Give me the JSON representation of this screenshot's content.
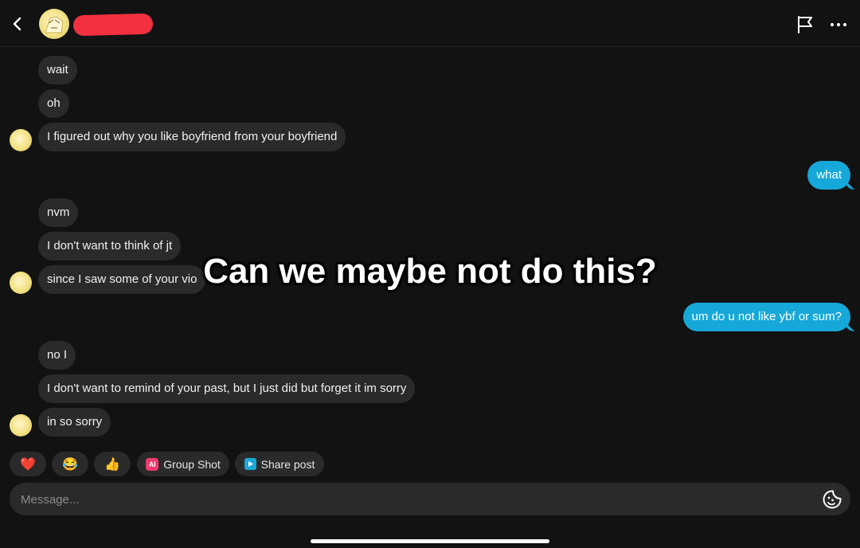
{
  "header": {
    "back_icon": "chevron-left-icon",
    "avatar": "profile-avatar",
    "redaction_color": "#f2303f",
    "actions": [
      "flag-icon",
      "more-icon"
    ]
  },
  "messages": [
    {
      "side": "in",
      "text": "wait"
    },
    {
      "side": "in",
      "text": "oh"
    },
    {
      "side": "in",
      "text": "I figured out why you like boyfriend from your boyfriend"
    },
    {
      "side": "out",
      "text": "what"
    },
    {
      "side": "in",
      "text": "nvm"
    },
    {
      "side": "in",
      "text": "I don't want to think of jt"
    },
    {
      "side": "in",
      "text": "since I saw some of your vio"
    },
    {
      "side": "out",
      "text": "um do u not like ybf or sum?"
    },
    {
      "side": "in",
      "text": "no I"
    },
    {
      "side": "in",
      "text": "I don't want to remind of your past, but I just did but forget it im sorry"
    },
    {
      "side": "in",
      "text": "in so sorry"
    }
  ],
  "overlay_caption": "Can we maybe not do this?",
  "quick_replies": [
    {
      "icon": "heart-icon",
      "emoji": "❤️"
    },
    {
      "icon": "laughing-icon",
      "emoji": "😂"
    },
    {
      "icon": "thumbs-up-icon",
      "emoji": "👍"
    },
    {
      "icon": "ai-icon",
      "badge": "AI",
      "label": "Group Shot"
    },
    {
      "icon": "share-icon",
      "label": "Share post"
    }
  ],
  "composer": {
    "placeholder": "Message...",
    "sticker_icon": "sticker-icon"
  },
  "colors": {
    "background": "#121212",
    "bubble_in": "#2a2a2a",
    "bubble_out": "#16a8d8",
    "text": "#ffffff"
  }
}
